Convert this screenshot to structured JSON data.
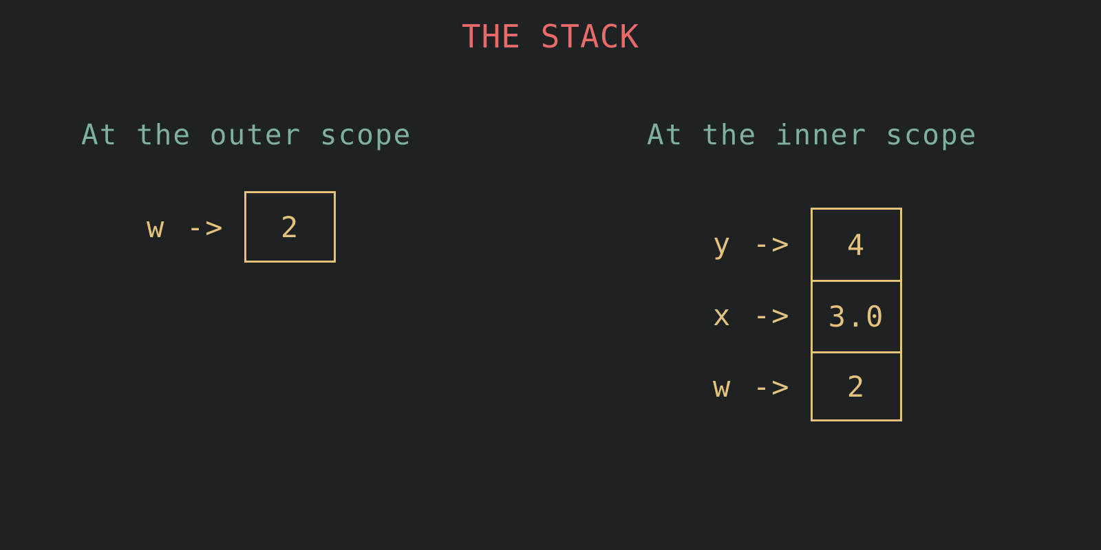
{
  "title": "THE STACK",
  "outer": {
    "heading": "At the outer scope",
    "entries": [
      {
        "name": "w",
        "arrow": "->",
        "value": "2"
      }
    ]
  },
  "inner": {
    "heading": "At the inner scope",
    "entries": [
      {
        "name": "y",
        "arrow": "->",
        "value": "4"
      },
      {
        "name": "x",
        "arrow": "->",
        "value": "3.0"
      },
      {
        "name": "w",
        "arrow": "->",
        "value": "2"
      }
    ]
  },
  "colors": {
    "background": "#1f2223",
    "title": "#e86a69",
    "heading": "#7fb0a2",
    "stack": "#e5c17c"
  }
}
